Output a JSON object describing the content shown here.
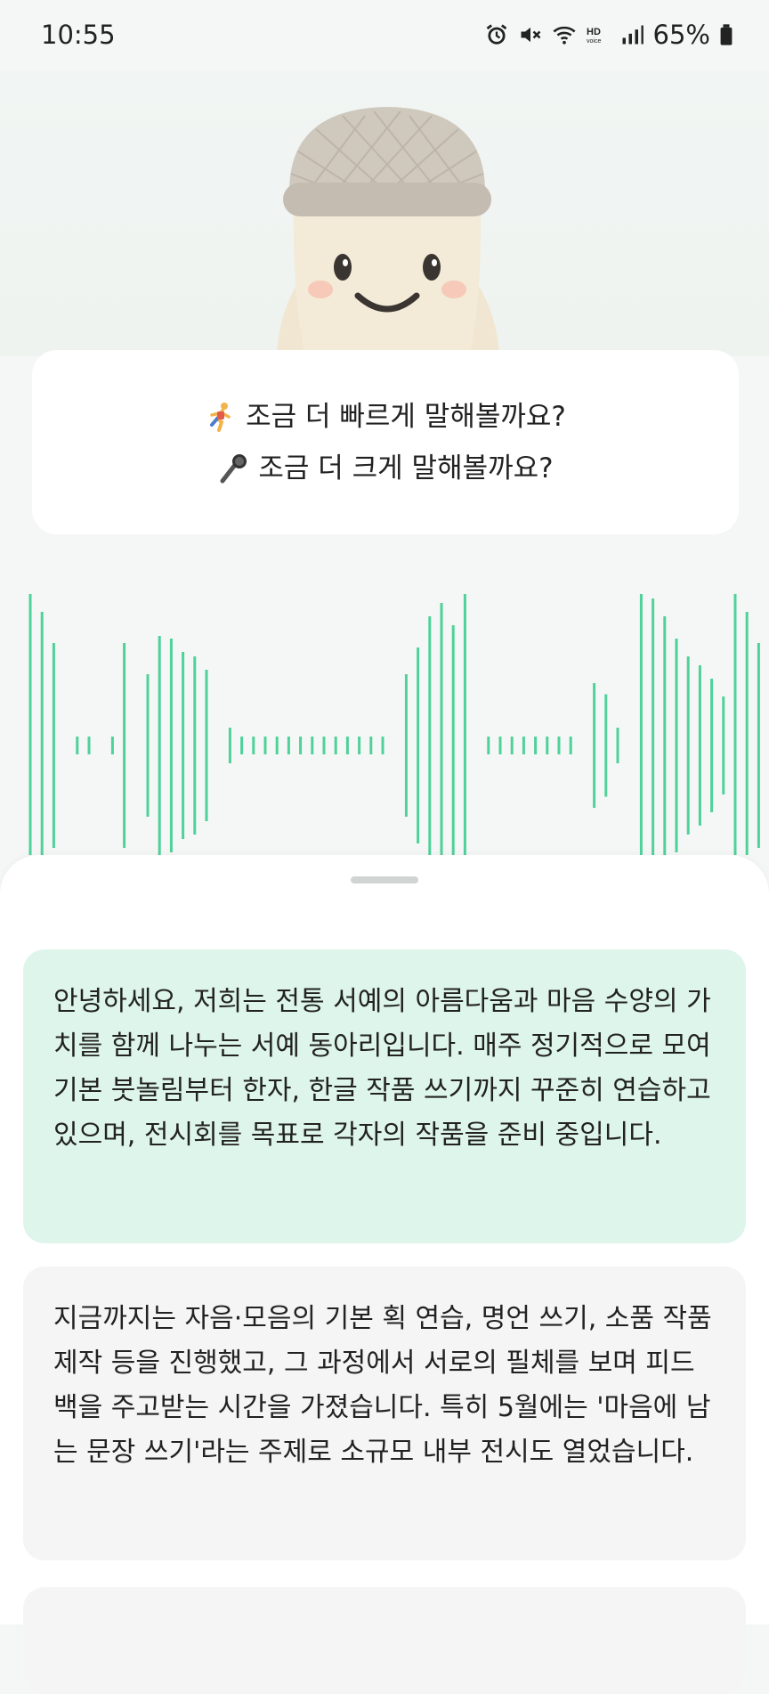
{
  "status_bar": {
    "time": "10:55",
    "battery": "65%",
    "icons": [
      "alarm-icon",
      "mute-icon",
      "wifi-icon",
      "hd-voice-icon",
      "signal-icon",
      "battery-icon"
    ]
  },
  "hero": {
    "mascot": "microphone-character"
  },
  "prompts": [
    {
      "icon": "running-person-emoji",
      "text": "조금 더 빠르게 말해볼까요?"
    },
    {
      "icon": "microphone-emoji",
      "text": "조금 더 크게 말해볼까요?"
    }
  ],
  "waveform": {
    "color": "#4fd19a",
    "level": "dynamic"
  },
  "transcript": {
    "messages": [
      {
        "state": "active",
        "text": "안녕하세요, 저희는 전통 서예의 아름다움과 마음 수양의 가치를 함께 나누는 서예 동아리입니다. 매주 정기적으로 모여 기본 붓놀림부터 한자, 한글 작품 쓰기까지 꾸준히 연습하고 있으며, 전시회를 목표로 각자의 작품을 준비 중입니다."
      },
      {
        "state": "pending",
        "text": "지금까지는 자음·모음의 기본 획 연습, 명언 쓰기, 소품 작품 제작 등을 진행했고, 그 과정에서 서로의 필체를 보며 피드백을 주고받는 시간을 가졌습니다. 특히 5월에는 '마음에 남는 문장 쓰기'라는 주제로 소규모 내부 전시도 열었습니다."
      }
    ]
  },
  "colors": {
    "accent": "#4fd19a",
    "active_bubble": "#def5eb",
    "pending_bubble": "#f5f5f5"
  }
}
